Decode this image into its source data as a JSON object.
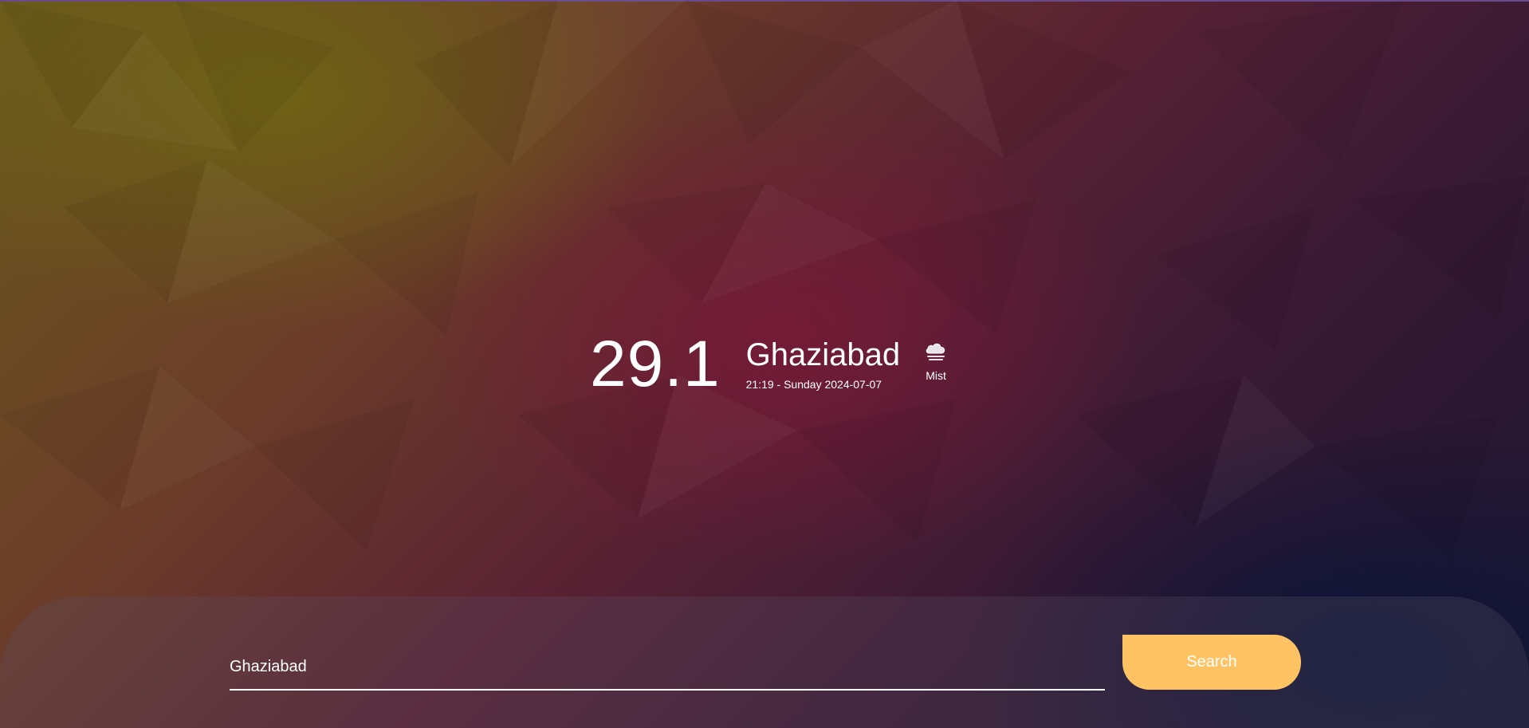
{
  "weather": {
    "temperature": "29.1",
    "city": "Ghaziabad",
    "datetime": "21:19 - Sunday 2024-07-07",
    "condition": "Mist",
    "condition_icon": "cloud-mist-icon"
  },
  "search": {
    "value": "Ghaziabad",
    "placeholder": "",
    "button_label": "Search"
  },
  "colors": {
    "button": "#ffc364",
    "text": "#ffffff"
  }
}
